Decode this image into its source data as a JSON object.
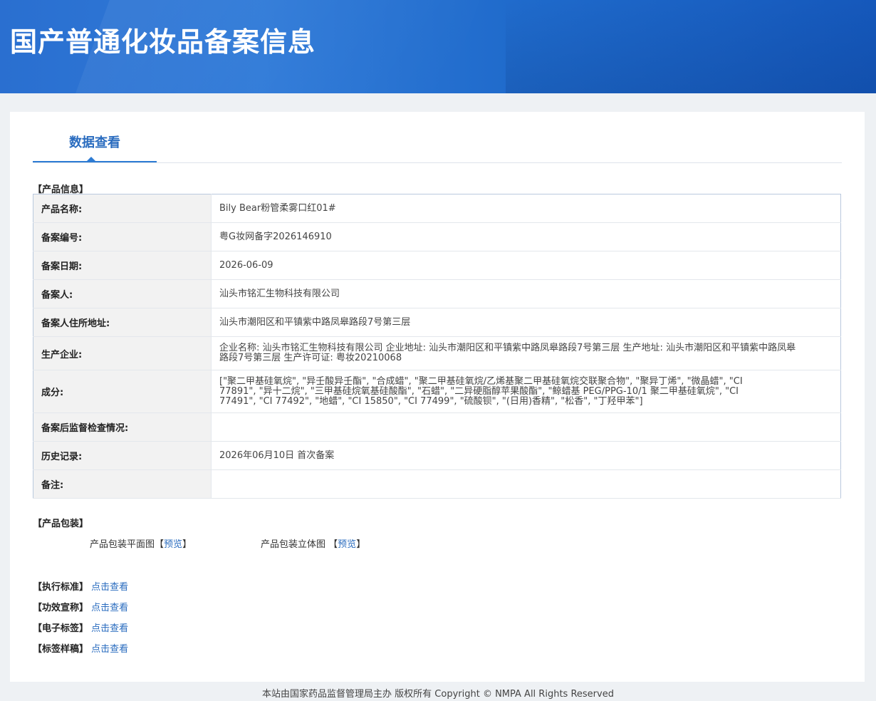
{
  "page": {
    "title": "国产普通化妆品备案信息",
    "tab": "数据查看"
  },
  "product_info": {
    "section_title": "【产品信息】",
    "rows": [
      {
        "label": "产品名称:",
        "value": "Bily Bear粉管柔雾口红01#"
      },
      {
        "label": "备案编号:",
        "value": "粤G妆网备字2026146910"
      },
      {
        "label": "备案日期:",
        "value": "2026-06-09"
      },
      {
        "label": "备案人:",
        "value": "汕头市铭汇生物科技有限公司"
      },
      {
        "label": "备案人住所地址:",
        "value": "汕头市潮阳区和平镇紫中路凤皋路段7号第三层"
      },
      {
        "label": "生产企业:",
        "value": "企业名称: 汕头市铭汇生物科技有限公司 企业地址: 汕头市潮阳区和平镇紫中路凤皋路段7号第三层 生产地址: 汕头市潮阳区和平镇紫中路凤皋路段7号第三层 生产许可证: 粤妆20210068"
      },
      {
        "label": "成分:",
        "value": "[\"聚二甲基硅氧烷\", \"异壬酸异壬酯\", \"合成蜡\", \"聚二甲基硅氧烷/乙烯基聚二甲基硅氧烷交联聚合物\", \"聚异丁烯\", \"微晶蜡\", \"CI 77891\", \"异十二烷\", \"三甲基硅烷氧基硅酸酯\", \"石蜡\", \"二异硬脂醇苹果酸酯\", \"鲸蜡基 PEG/PPG-10/1 聚二甲基硅氧烷\", \"CI 77491\", \"CI 77492\", \"地蜡\", \"CI 15850\", \"CI 77499\", \"硫酸钡\", \"(日用)香精\", \"松香\", \"丁羟甲苯\"]"
      },
      {
        "label": "备案后监督检查情况:",
        "value": ""
      },
      {
        "label": "历史记录:",
        "value": "2026年06月10日 首次备案"
      },
      {
        "label": "备注:",
        "value": ""
      }
    ]
  },
  "packaging": {
    "section_title": "【产品包装】",
    "flat_label": "产品包装平面图",
    "stereo_label": "产品包装立体图",
    "bracket_open": "【",
    "bracket_close": "】",
    "preview_link": "预览"
  },
  "links": [
    {
      "label": "【执行标准】",
      "action": "点击查看"
    },
    {
      "label": "【功效宣称】",
      "action": "点击查看"
    },
    {
      "label": "【电子标签】",
      "action": "点击查看"
    },
    {
      "label": "【标签样稿】",
      "action": "点击查看"
    }
  ],
  "footer": "本站由国家药品监督管理局主办 版权所有 Copyright © NMPA All Rights Reserved",
  "colors": {
    "banner": "#2a6fd0",
    "link": "#2a6cbf",
    "tab_accent": "#2d7bd3",
    "label_bg": "#f2f2f2"
  }
}
